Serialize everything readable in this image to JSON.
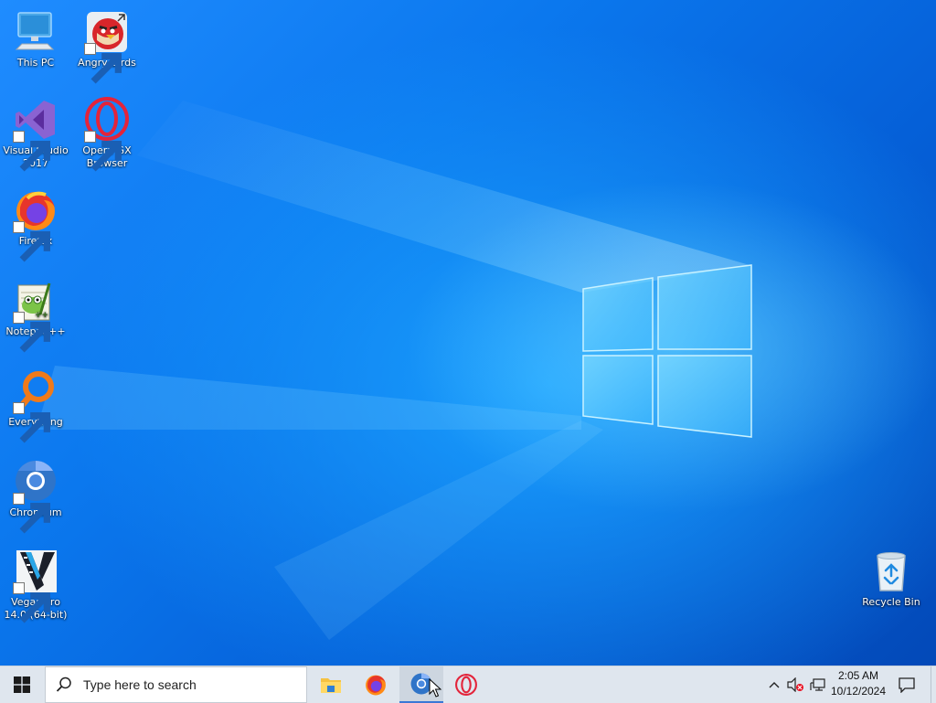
{
  "desktop": {
    "icons": [
      {
        "id": "this-pc",
        "label": "This PC",
        "icon": "monitor-icon",
        "shortcut": false
      },
      {
        "id": "angry-birds",
        "label": "Angry Birds",
        "icon": "angry-birds-icon",
        "shortcut": true
      },
      {
        "id": "visual-studio",
        "label": "Visual Studio 2017",
        "icon": "visual-studio-icon",
        "shortcut": true
      },
      {
        "id": "opera-gx",
        "label": "Opera GX Browser",
        "icon": "opera-icon",
        "shortcut": true
      },
      {
        "id": "firefox",
        "label": "Firefox",
        "icon": "firefox-icon",
        "shortcut": true
      },
      {
        "id": "notepadpp",
        "label": "Notepad++",
        "icon": "notepadpp-icon",
        "shortcut": true
      },
      {
        "id": "everything",
        "label": "Everything",
        "icon": "everything-icon",
        "shortcut": true
      },
      {
        "id": "chromium",
        "label": "Chromium",
        "icon": "chromium-icon",
        "shortcut": true
      },
      {
        "id": "vegas-pro",
        "label": "Vegas Pro 14.0 (64-bit)",
        "icon": "vegas-icon",
        "shortcut": true
      },
      {
        "id": "recycle-bin",
        "label": "Recycle Bin",
        "icon": "recycle-bin-icon",
        "shortcut": false
      }
    ]
  },
  "taskbar": {
    "start_icon": "windows-logo-icon",
    "search": {
      "placeholder": "Type here to search",
      "icon": "search-icon"
    },
    "pinned_apps": [
      {
        "id": "file-explorer",
        "icon": "folder-icon",
        "active": false
      },
      {
        "id": "firefox",
        "icon": "firefox-icon",
        "active": false
      },
      {
        "id": "chromium",
        "icon": "chromium-icon",
        "active": true
      },
      {
        "id": "opera",
        "icon": "opera-icon",
        "active": false
      }
    ],
    "tray": {
      "icons": [
        "chevron-up-icon",
        "speaker-muted-icon",
        "network-icon"
      ],
      "time": "2:05 AM",
      "date": "10/12/2024",
      "notification_icon": "action-center-icon"
    }
  },
  "colors": {
    "wallpaper_primary": "#0b78ee",
    "taskbar_bg": "#dfe6ee",
    "accent": "#3b78d6"
  }
}
